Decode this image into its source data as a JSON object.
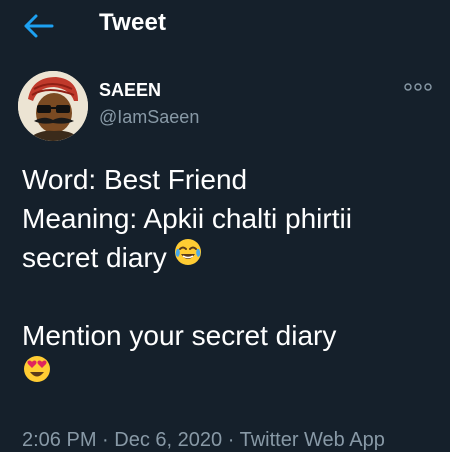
{
  "header": {
    "back_icon": "arrow-left-icon",
    "title": "Tweet",
    "accent_color": "#1da1f2"
  },
  "author": {
    "display_name": "SAEEN",
    "handle": "@IamSaeen",
    "avatar_icon": "cartoon-avatar"
  },
  "more_icon": "more-dots-icon",
  "tweet": {
    "line1": "Word: Best Friend",
    "line2": "Meaning: Apkii chalti phirtii",
    "line3": "secret diary",
    "line3_emoji": "face-with-tears-of-joy-emoji",
    "line4": "Mention your secret diary",
    "line5_emoji": "smiling-face-with-heart-eyes-emoji"
  },
  "meta": {
    "time": "2:06 PM",
    "separator": "·",
    "date": "Dec 6, 2020",
    "source": "Twitter Web App"
  },
  "colors": {
    "background": "#15202b",
    "primary_text": "#ffffff",
    "secondary_text": "#8899a6"
  }
}
